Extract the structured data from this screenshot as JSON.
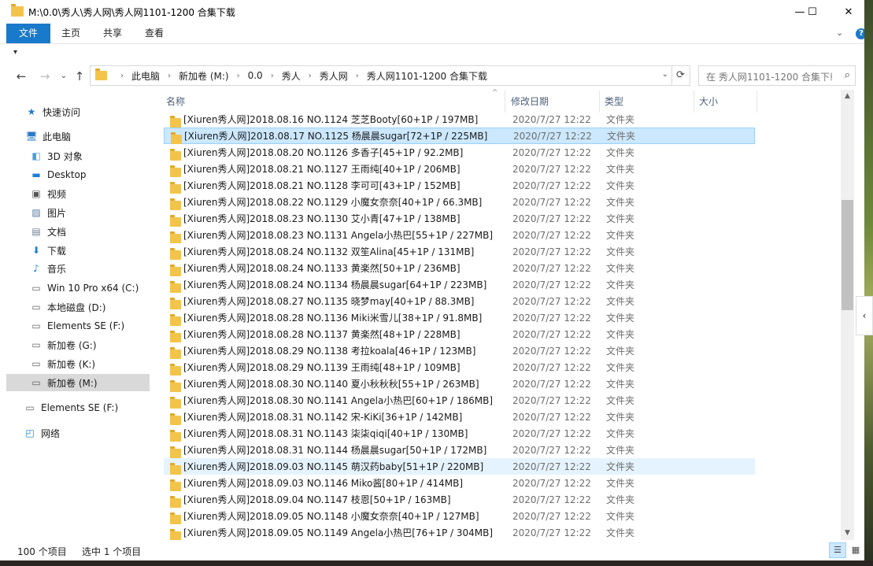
{
  "window": {
    "title": "M:\\0.0\\秀人\\秀人网\\秀人网1101-1200 合集下载",
    "minimize": "—",
    "maximize": "☐",
    "close": "✕"
  },
  "ribbon": {
    "tabs": [
      "文件",
      "主页",
      "共享",
      "查看"
    ],
    "expand": "⌄",
    "help": "?"
  },
  "qat": {
    "arrow": "▾"
  },
  "nav": {
    "back": "←",
    "forward": "→",
    "recent": "⌄",
    "up": "↑",
    "breadcrumbs": [
      "此电脑",
      "新加卷 (M:)",
      "0.0",
      "秀人",
      "秀人网",
      "秀人网1101-1200 合集下载"
    ],
    "dropdown": "⌄",
    "refresh": "⟳",
    "search_placeholder": "在 秀人网1101-1200 合集下载..."
  },
  "sidebar": {
    "items": [
      {
        "label": "快速访问",
        "icon": "★"
      },
      {
        "label": "此电脑",
        "icon": "🖥"
      },
      {
        "label": "3D 对象",
        "icon": "◧"
      },
      {
        "label": "Desktop",
        "icon": "▬"
      },
      {
        "label": "视频",
        "icon": "▣"
      },
      {
        "label": "图片",
        "icon": "▨"
      },
      {
        "label": "文档",
        "icon": "▤"
      },
      {
        "label": "下载",
        "icon": "⬇"
      },
      {
        "label": "音乐",
        "icon": "♪"
      },
      {
        "label": "Win 10 Pro x64 (C:)",
        "icon": "▭"
      },
      {
        "label": "本地磁盘 (D:)",
        "icon": "▭"
      },
      {
        "label": "Elements SE (F:)",
        "icon": "▭"
      },
      {
        "label": "新加卷 (G:)",
        "icon": "▭"
      },
      {
        "label": "新加卷 (K:)",
        "icon": "▭"
      },
      {
        "label": "新加卷 (M:)",
        "icon": "▭"
      },
      {
        "label": "Elements SE (F:)",
        "icon": "▭"
      },
      {
        "label": "网络",
        "icon": "◰"
      }
    ]
  },
  "columns": {
    "name": "名称",
    "date": "修改日期",
    "type": "类型",
    "size": "大小",
    "sort": "^"
  },
  "files": [
    {
      "name": "[Xiuren秀人网]2018.08.16 NO.1124 芝芝Booty[60+1P / 197MB]",
      "date": "2020/7/27 12:22",
      "type": "文件夹"
    },
    {
      "name": "[Xiuren秀人网]2018.08.17 NO.1125 杨晨晨sugar[72+1P / 225MB]",
      "date": "2020/7/27 12:22",
      "type": "文件夹"
    },
    {
      "name": "[Xiuren秀人网]2018.08.20 NO.1126 多香子[45+1P / 92.2MB]",
      "date": "2020/7/27 12:22",
      "type": "文件夹"
    },
    {
      "name": "[Xiuren秀人网]2018.08.21 NO.1127 王雨纯[40+1P / 206MB]",
      "date": "2020/7/27 12:22",
      "type": "文件夹"
    },
    {
      "name": "[Xiuren秀人网]2018.08.21 NO.1128 李可可[43+1P / 152MB]",
      "date": "2020/7/27 12:22",
      "type": "文件夹"
    },
    {
      "name": "[Xiuren秀人网]2018.08.22 NO.1129 小魔女奈奈[40+1P / 66.3MB]",
      "date": "2020/7/27 12:22",
      "type": "文件夹"
    },
    {
      "name": "[Xiuren秀人网]2018.08.23 NO.1130 艾小青[47+1P / 138MB]",
      "date": "2020/7/27 12:22",
      "type": "文件夹"
    },
    {
      "name": "[Xiuren秀人网]2018.08.23 NO.1131 Angela小热巴[55+1P / 227MB]",
      "date": "2020/7/27 12:22",
      "type": "文件夹"
    },
    {
      "name": "[Xiuren秀人网]2018.08.24 NO.1132 双笙Alina[45+1P / 131MB]",
      "date": "2020/7/27 12:22",
      "type": "文件夹"
    },
    {
      "name": "[Xiuren秀人网]2018.08.24 NO.1133 黄楽然[50+1P / 236MB]",
      "date": "2020/7/27 12:22",
      "type": "文件夹"
    },
    {
      "name": "[Xiuren秀人网]2018.08.24 NO.1134 杨晨晨sugar[64+1P / 223MB]",
      "date": "2020/7/27 12:22",
      "type": "文件夹"
    },
    {
      "name": "[Xiuren秀人网]2018.08.27 NO.1135 晓梦may[40+1P / 88.3MB]",
      "date": "2020/7/27 12:22",
      "type": "文件夹"
    },
    {
      "name": "[Xiuren秀人网]2018.08.28 NO.1136 Miki米雪儿[38+1P / 91.8MB]",
      "date": "2020/7/27 12:22",
      "type": "文件夹"
    },
    {
      "name": "[Xiuren秀人网]2018.08.28 NO.1137 黄楽然[48+1P / 228MB]",
      "date": "2020/7/27 12:22",
      "type": "文件夹"
    },
    {
      "name": "[Xiuren秀人网]2018.08.29 NO.1138 考拉koala[46+1P / 123MB]",
      "date": "2020/7/27 12:22",
      "type": "文件夹"
    },
    {
      "name": "[Xiuren秀人网]2018.08.29 NO.1139 王雨纯[48+1P / 109MB]",
      "date": "2020/7/27 12:22",
      "type": "文件夹"
    },
    {
      "name": "[Xiuren秀人网]2018.08.30 NO.1140 夏小秋秋秋[55+1P / 263MB]",
      "date": "2020/7/27 12:22",
      "type": "文件夹"
    },
    {
      "name": "[Xiuren秀人网]2018.08.30 NO.1141 Angela小热巴[60+1P / 186MB]",
      "date": "2020/7/27 12:22",
      "type": "文件夹"
    },
    {
      "name": "[Xiuren秀人网]2018.08.31 NO.1142 宋-KiKi[36+1P / 142MB]",
      "date": "2020/7/27 12:22",
      "type": "文件夹"
    },
    {
      "name": "[Xiuren秀人网]2018.08.31 NO.1143 柒柒qiqi[40+1P / 130MB]",
      "date": "2020/7/27 12:22",
      "type": "文件夹"
    },
    {
      "name": "[Xiuren秀人网]2018.08.31 NO.1144 杨晨晨sugar[50+1P / 172MB]",
      "date": "2020/7/27 12:22",
      "type": "文件夹"
    },
    {
      "name": "[Xiuren秀人网]2018.09.03 NO.1145 萌汉药baby[51+1P / 220MB]",
      "date": "2020/7/27 12:22",
      "type": "文件夹"
    },
    {
      "name": "[Xiuren秀人网]2018.09.03 NO.1146 Miko酱[80+1P / 414MB]",
      "date": "2020/7/27 12:22",
      "type": "文件夹"
    },
    {
      "name": "[Xiuren秀人网]2018.09.04 NO.1147 枝恩[50+1P / 163MB]",
      "date": "2020/7/27 12:22",
      "type": "文件夹"
    },
    {
      "name": "[Xiuren秀人网]2018.09.05 NO.1148 小魔女奈奈[40+1P / 127MB]",
      "date": "2020/7/27 12:22",
      "type": "文件夹"
    },
    {
      "name": "[Xiuren秀人网]2018.09.05 NO.1149 Angela小热巴[76+1P / 304MB]",
      "date": "2020/7/27 12:22",
      "type": "文件夹"
    }
  ],
  "scrollbar": {
    "up": "▲",
    "down": "▼"
  },
  "side_tab": "‹",
  "status": {
    "count": "100 个项目",
    "selected": "选中 1 个项目",
    "details_view": "☰",
    "icons_view": "▦"
  },
  "colors": {
    "accent": "#1979ca",
    "selection": "#cce8ff",
    "folder": "#f3c44b"
  }
}
